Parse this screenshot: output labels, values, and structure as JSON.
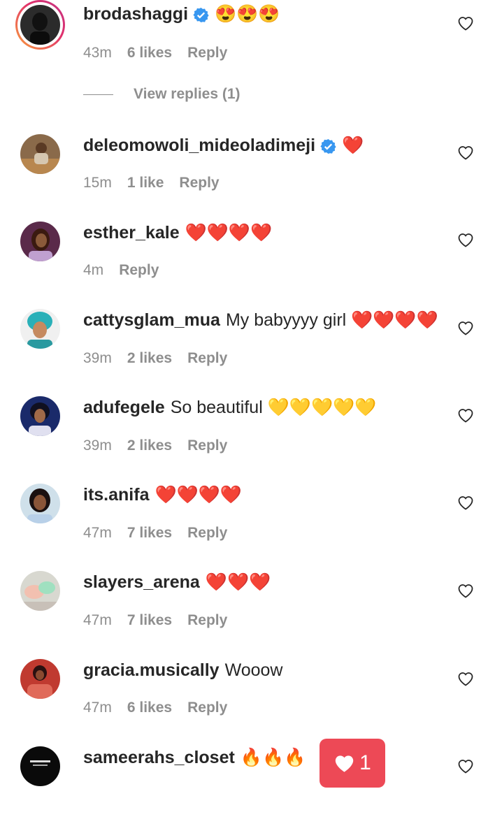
{
  "comments": [
    {
      "username": "brodashaggi",
      "verified": true,
      "text": "😍😍😍",
      "time": "43m",
      "likes": "6 likes",
      "reply": "Reply",
      "avatar_icon": "profile-photo-icon",
      "has_story": true
    },
    {
      "username": "deleomowoli_mideoladimeji",
      "verified": true,
      "text": "❤️",
      "time": "15m",
      "likes": "1 like",
      "reply": "Reply",
      "avatar_icon": "profile-photo-icon"
    },
    {
      "username": "esther_kale",
      "verified": false,
      "text": "❤️❤️❤️❤️",
      "time": "4m",
      "likes": "",
      "reply": "Reply",
      "avatar_icon": "profile-photo-icon"
    },
    {
      "username": "cattysglam_mua",
      "verified": false,
      "text": "My babyyyy girl ❤️❤️❤️❤️",
      "time": "39m",
      "likes": "2 likes",
      "reply": "Reply",
      "avatar_icon": "profile-photo-icon"
    },
    {
      "username": "adufegele",
      "verified": false,
      "text": "So beautiful 💛💛💛💛💛",
      "time": "39m",
      "likes": "2 likes",
      "reply": "Reply",
      "avatar_icon": "profile-photo-icon"
    },
    {
      "username": "its.anifa",
      "verified": false,
      "text": "❤️❤️❤️❤️",
      "time": "47m",
      "likes": "7 likes",
      "reply": "Reply",
      "avatar_icon": "profile-photo-icon"
    },
    {
      "username": "slayers_arena",
      "verified": false,
      "text": "❤️❤️❤️",
      "time": "47m",
      "likes": "7 likes",
      "reply": "Reply",
      "avatar_icon": "profile-photo-icon"
    },
    {
      "username": "gracia.musically",
      "verified": false,
      "text": "Wooow",
      "time": "47m",
      "likes": "6 likes",
      "reply": "Reply",
      "avatar_icon": "profile-photo-icon"
    },
    {
      "username": "sameerahs_closet",
      "verified": false,
      "text": "🔥🔥🔥",
      "time": "",
      "likes": "",
      "reply": "",
      "avatar_icon": "profile-photo-icon"
    }
  ],
  "view_replies": "View replies (1)",
  "like_toast": {
    "count": "1",
    "icon": "heart-icon",
    "color": "#ed4956"
  },
  "colors": {
    "username": "#262626",
    "meta": "#8e8e8e",
    "verified": "#3897f0",
    "like_badge": "#ed4956"
  }
}
